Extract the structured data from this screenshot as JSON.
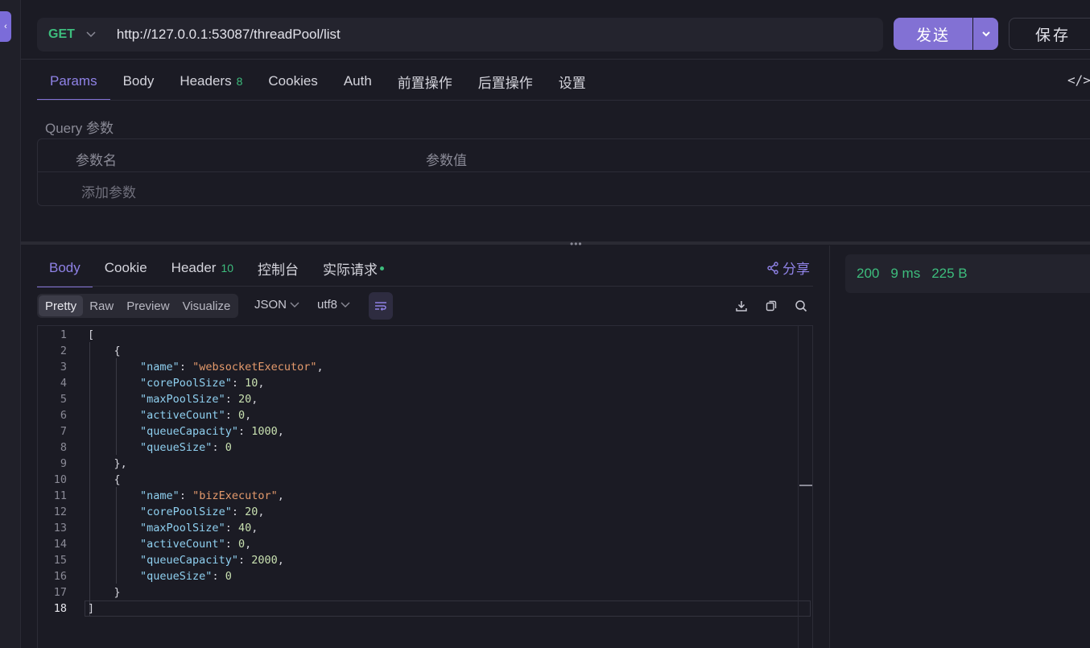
{
  "request": {
    "method": "GET",
    "url": "http://127.0.0.1:53087/threadPool/list",
    "send_label": "发送",
    "save_label": "保存"
  },
  "request_tabs": [
    {
      "label": "Params",
      "active": true
    },
    {
      "label": "Body"
    },
    {
      "label": "Headers",
      "badge": "8"
    },
    {
      "label": "Cookies"
    },
    {
      "label": "Auth"
    },
    {
      "label": "前置操作"
    },
    {
      "label": "后置操作"
    },
    {
      "label": "设置"
    }
  ],
  "params": {
    "section_label": "Query 参数",
    "col_name": "参数名",
    "col_value": "参数值",
    "add_placeholder": "添加参数"
  },
  "response_tabs": [
    {
      "label": "Body",
      "active": true
    },
    {
      "label": "Cookie"
    },
    {
      "label": "Header",
      "badge": "10"
    },
    {
      "label": "控制台"
    },
    {
      "label": "实际请求",
      "dot": true
    }
  ],
  "share_label": "分享",
  "toolbar": {
    "views": [
      "Pretty",
      "Raw",
      "Preview",
      "Visualize"
    ],
    "active_view": "Pretty",
    "format": "JSON",
    "encoding": "utf8"
  },
  "status": {
    "code": "200",
    "time": "9 ms",
    "size": "225 B"
  },
  "code_lines": [
    [
      [
        "p",
        "["
      ]
    ],
    [
      [
        "p",
        "    {"
      ]
    ],
    [
      [
        "p",
        "        "
      ],
      [
        "k",
        "\"name\""
      ],
      [
        "p",
        ": "
      ],
      [
        "s",
        "\"websocketExecutor\""
      ],
      [
        "p",
        ","
      ]
    ],
    [
      [
        "p",
        "        "
      ],
      [
        "k",
        "\"corePoolSize\""
      ],
      [
        "p",
        ": "
      ],
      [
        "n",
        "10"
      ],
      [
        "p",
        ","
      ]
    ],
    [
      [
        "p",
        "        "
      ],
      [
        "k",
        "\"maxPoolSize\""
      ],
      [
        "p",
        ": "
      ],
      [
        "n",
        "20"
      ],
      [
        "p",
        ","
      ]
    ],
    [
      [
        "p",
        "        "
      ],
      [
        "k",
        "\"activeCount\""
      ],
      [
        "p",
        ": "
      ],
      [
        "n",
        "0"
      ],
      [
        "p",
        ","
      ]
    ],
    [
      [
        "p",
        "        "
      ],
      [
        "k",
        "\"queueCapacity\""
      ],
      [
        "p",
        ": "
      ],
      [
        "n",
        "1000"
      ],
      [
        "p",
        ","
      ]
    ],
    [
      [
        "p",
        "        "
      ],
      [
        "k",
        "\"queueSize\""
      ],
      [
        "p",
        ": "
      ],
      [
        "n",
        "0"
      ]
    ],
    [
      [
        "p",
        "    },"
      ]
    ],
    [
      [
        "p",
        "    {"
      ]
    ],
    [
      [
        "p",
        "        "
      ],
      [
        "k",
        "\"name\""
      ],
      [
        "p",
        ": "
      ],
      [
        "s",
        "\"bizExecutor\""
      ],
      [
        "p",
        ","
      ]
    ],
    [
      [
        "p",
        "        "
      ],
      [
        "k",
        "\"corePoolSize\""
      ],
      [
        "p",
        ": "
      ],
      [
        "n",
        "20"
      ],
      [
        "p",
        ","
      ]
    ],
    [
      [
        "p",
        "        "
      ],
      [
        "k",
        "\"maxPoolSize\""
      ],
      [
        "p",
        ": "
      ],
      [
        "n",
        "40"
      ],
      [
        "p",
        ","
      ]
    ],
    [
      [
        "p",
        "        "
      ],
      [
        "k",
        "\"activeCount\""
      ],
      [
        "p",
        ": "
      ],
      [
        "n",
        "0"
      ],
      [
        "p",
        ","
      ]
    ],
    [
      [
        "p",
        "        "
      ],
      [
        "k",
        "\"queueCapacity\""
      ],
      [
        "p",
        ": "
      ],
      [
        "n",
        "2000"
      ],
      [
        "p",
        ","
      ]
    ],
    [
      [
        "p",
        "        "
      ],
      [
        "k",
        "\"queueSize\""
      ],
      [
        "p",
        ": "
      ],
      [
        "n",
        "0"
      ]
    ],
    [
      [
        "p",
        "    }"
      ]
    ],
    [
      [
        "p",
        "]"
      ]
    ]
  ],
  "current_line": 18
}
